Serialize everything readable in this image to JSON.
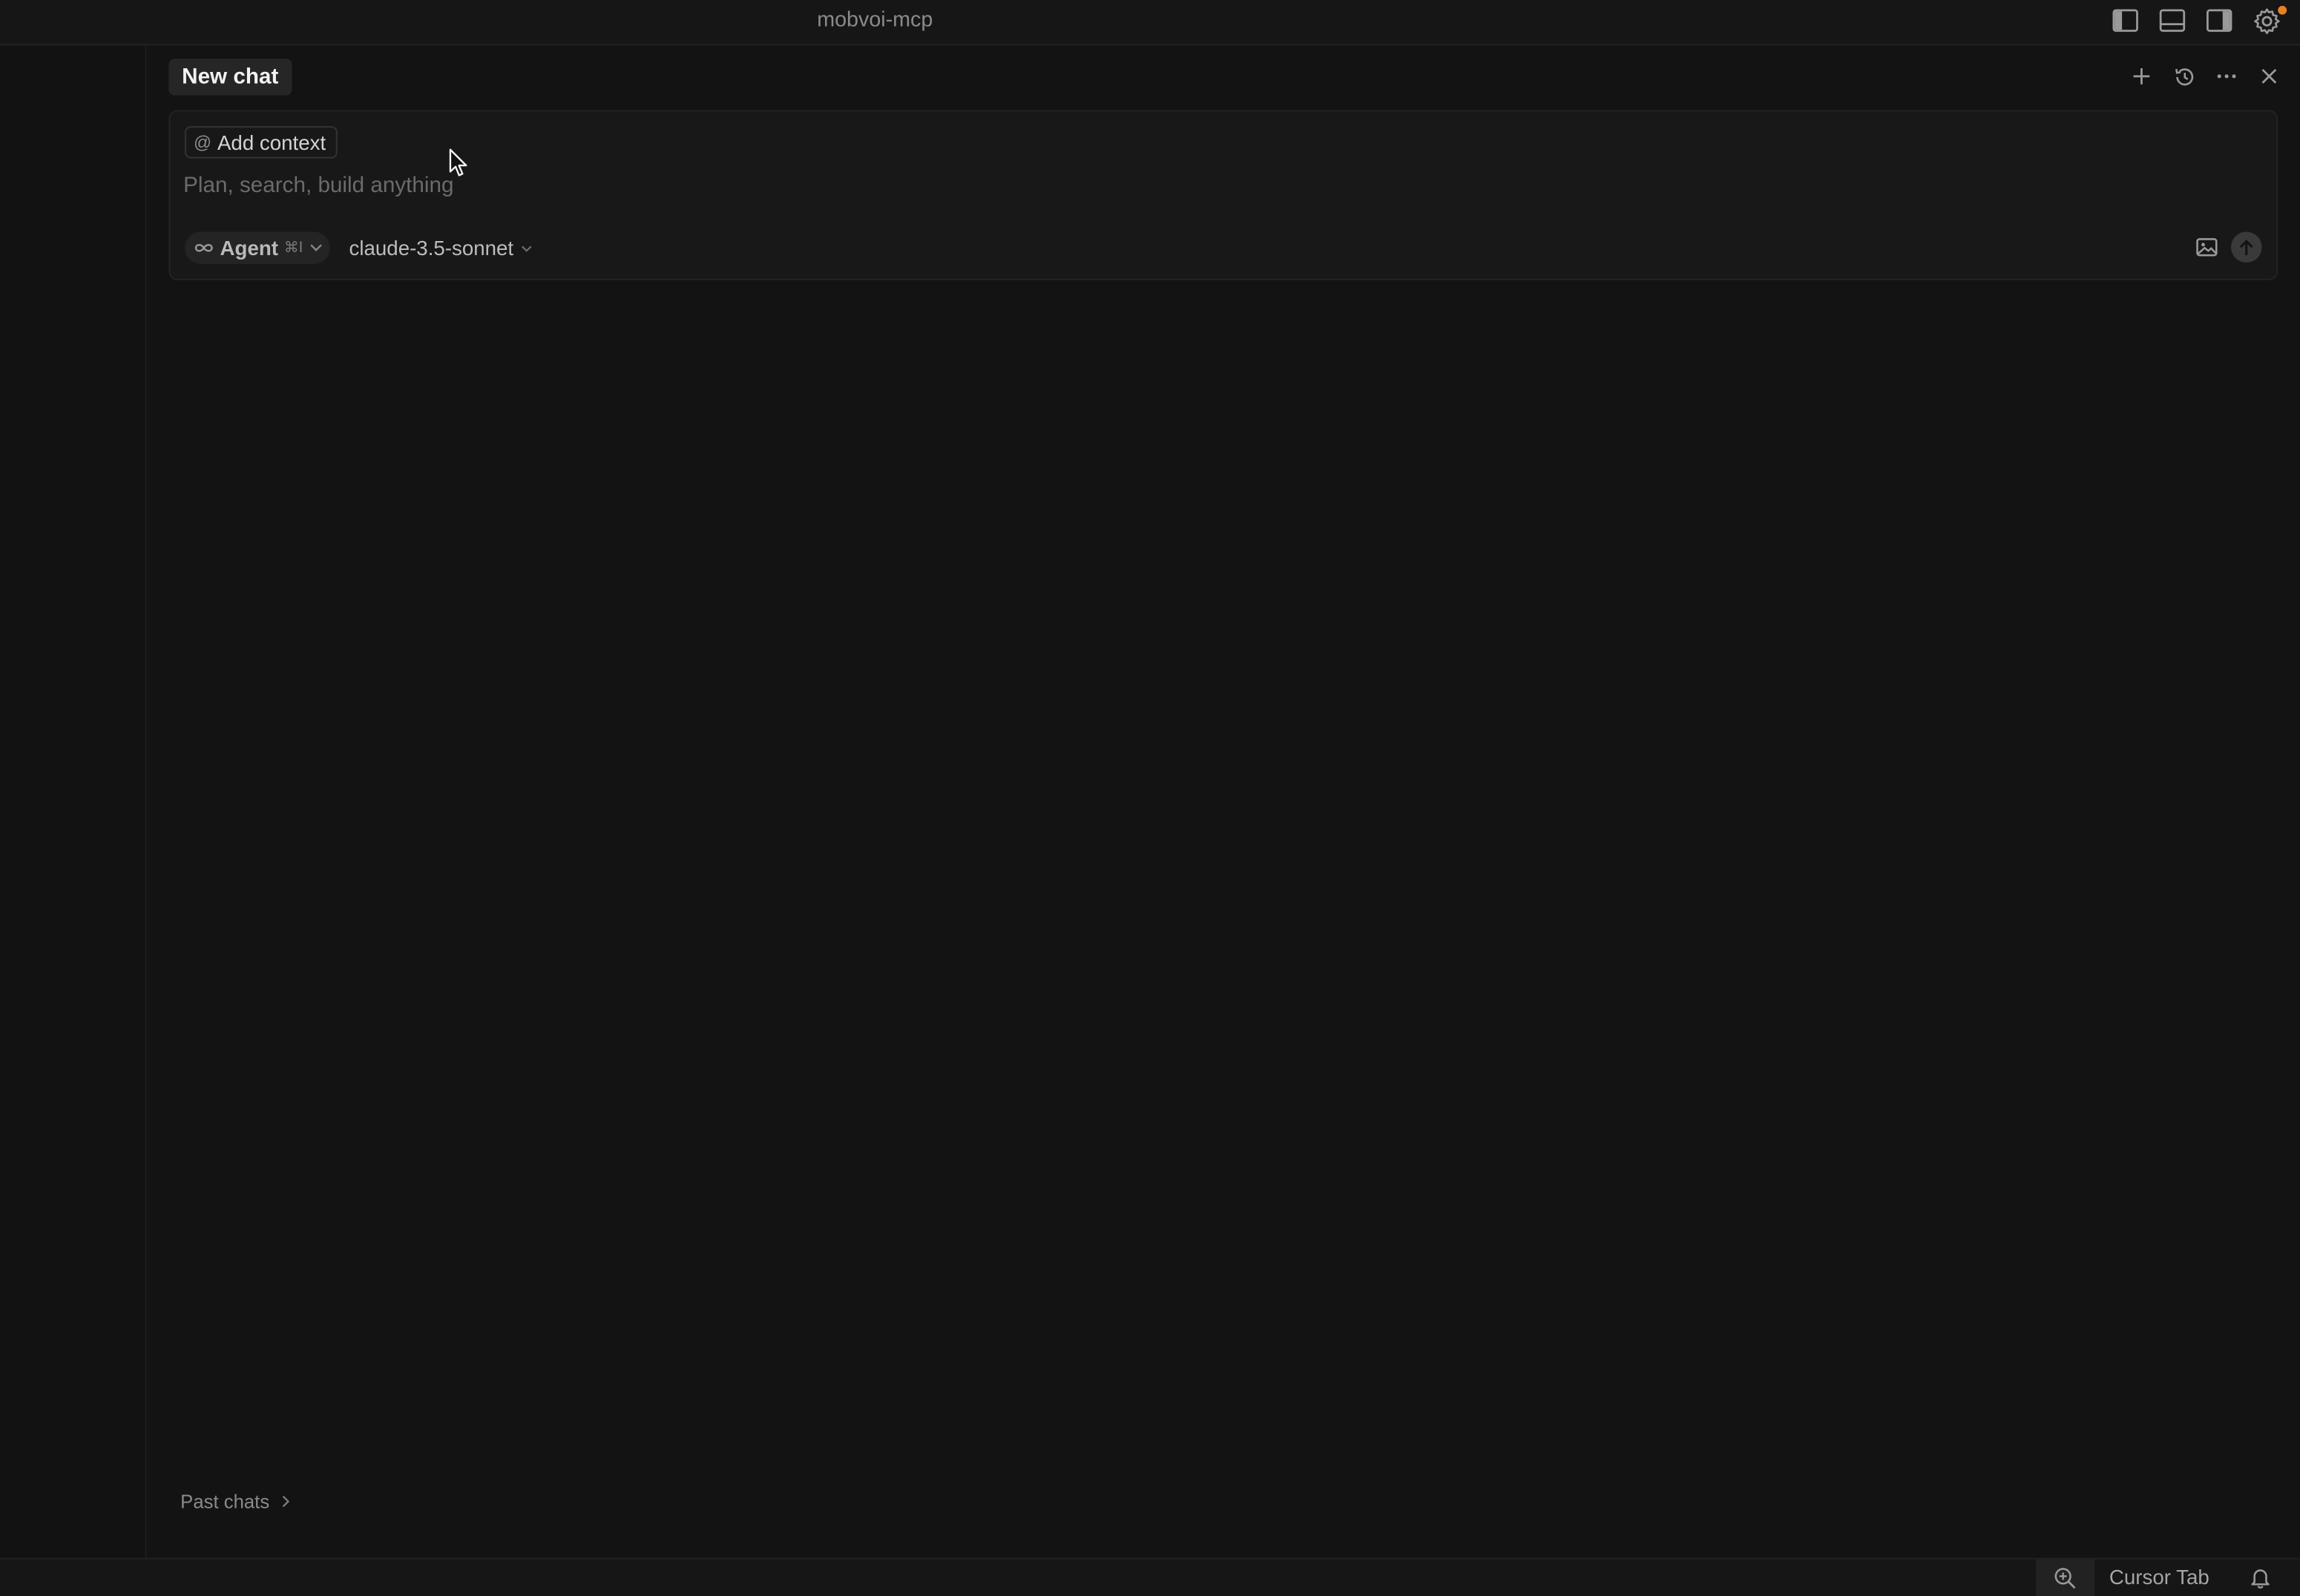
{
  "window": {
    "title": "mobvoi-mcp"
  },
  "titlebar_icons": [
    "toggle-primary-sidebar-icon",
    "toggle-panel-icon",
    "toggle-secondary-sidebar-icon",
    "gear-icon"
  ],
  "chat": {
    "tab_label": "New chat",
    "header_actions": [
      "plus-icon",
      "history-icon",
      "more-icon",
      "close-icon"
    ],
    "composer": {
      "add_context_label": "Add context",
      "placeholder": "Plan, search, build anything",
      "value": "",
      "mode_label": "Agent",
      "mode_shortcut": "⌘I",
      "model_label": "claude-3.5-sonnet"
    },
    "past_chats_label": "Past chats"
  },
  "statusbar": {
    "cursor_tab_label": "Cursor Tab"
  },
  "colors": {
    "background": "#131313",
    "notification_dot": "#e8821e"
  }
}
